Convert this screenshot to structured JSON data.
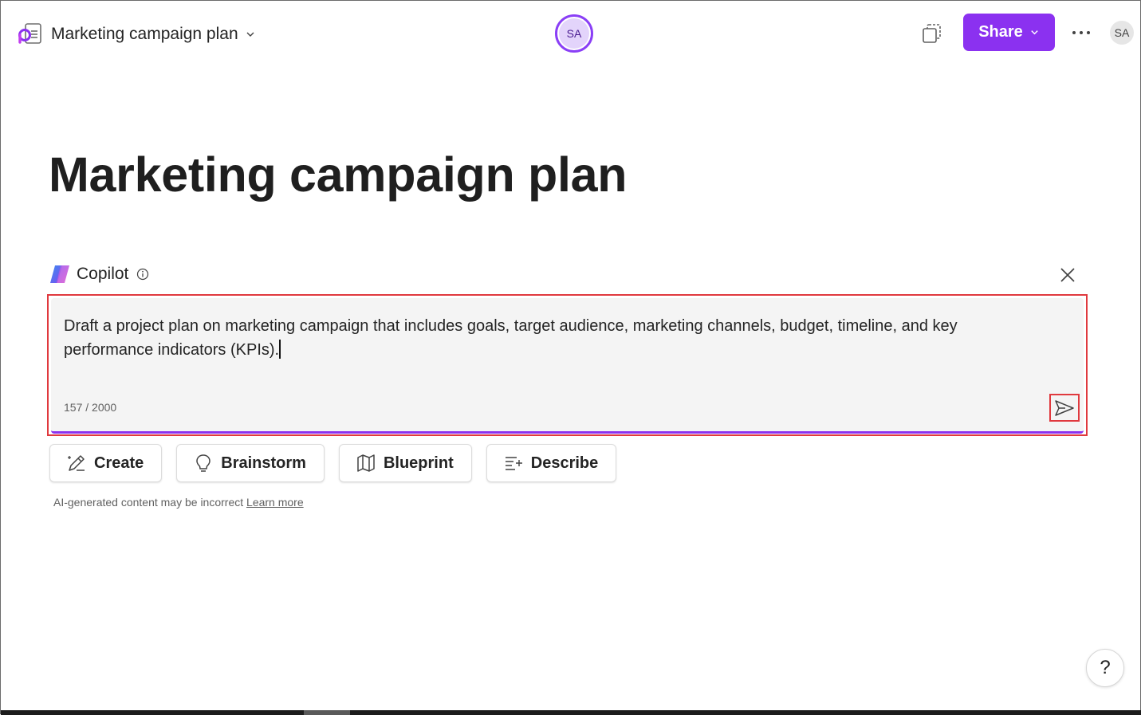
{
  "header": {
    "doc_title": "Marketing campaign plan",
    "collaborator_initials": "SA",
    "share_label": "Share",
    "user_initials": "SA"
  },
  "page": {
    "title": "Marketing campaign plan"
  },
  "copilot": {
    "label": "Copilot",
    "prompt_text": "Draft a project plan on marketing campaign that includes goals, target audience, marketing channels, budget, timeline, and key performance indicators (KPIs).",
    "char_count": "157 / 2000",
    "chips": [
      {
        "label": "Create",
        "icon": "pen-sparkle-icon"
      },
      {
        "label": "Brainstorm",
        "icon": "lightbulb-icon"
      },
      {
        "label": "Blueprint",
        "icon": "map-icon"
      },
      {
        "label": "Describe",
        "icon": "text-sparkle-icon"
      }
    ],
    "disclaimer": "AI-generated content may be incorrect",
    "learn_more": "Learn more"
  },
  "help": {
    "label": "?"
  },
  "colors": {
    "accent": "#8b31f0",
    "highlight_border": "#e0393e",
    "prompt_bg": "#f4f4f4"
  }
}
